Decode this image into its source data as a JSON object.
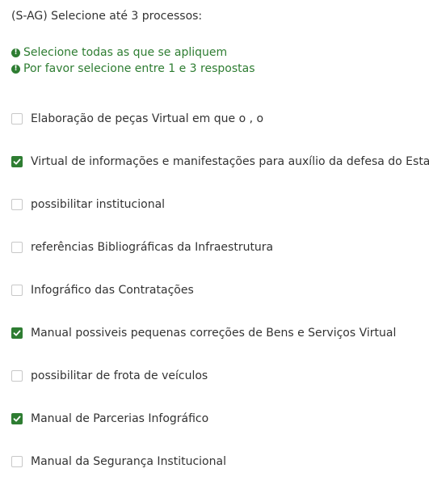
{
  "question": {
    "text": "(S-AG) Selecione até 3 processos:"
  },
  "tips": [
    {
      "icon": "exclamation-circle-icon",
      "text": "Selecione todas as que se apliquem"
    },
    {
      "icon": "exclamation-circle-icon",
      "text": "Por favor selecione entre 1 e 3 respostas"
    }
  ],
  "options": [
    {
      "label": "Elaboração de peças Virtual em que o , o",
      "checked": false
    },
    {
      "label": "Virtual de informações e manifestações para auxílio da defesa do Estado",
      "checked": true
    },
    {
      "label": "possibilitar institucional",
      "checked": false
    },
    {
      "label": "referências Bibliográficas da Infraestrutura",
      "checked": false
    },
    {
      "label": "Infográfico das Contratações",
      "checked": false
    },
    {
      "label": "Manual possiveis pequenas correções de Bens e Serviços Virtual",
      "checked": true
    },
    {
      "label": "possibilitar de frota de veículos",
      "checked": false
    },
    {
      "label": "Manual de Parcerias Infográfico",
      "checked": true
    },
    {
      "label": "Manual da Segurança Institucional",
      "checked": false
    }
  ],
  "colors": {
    "accent": "#2e7d32",
    "text": "#333333",
    "checkbox_border": "#c8c8c8"
  }
}
